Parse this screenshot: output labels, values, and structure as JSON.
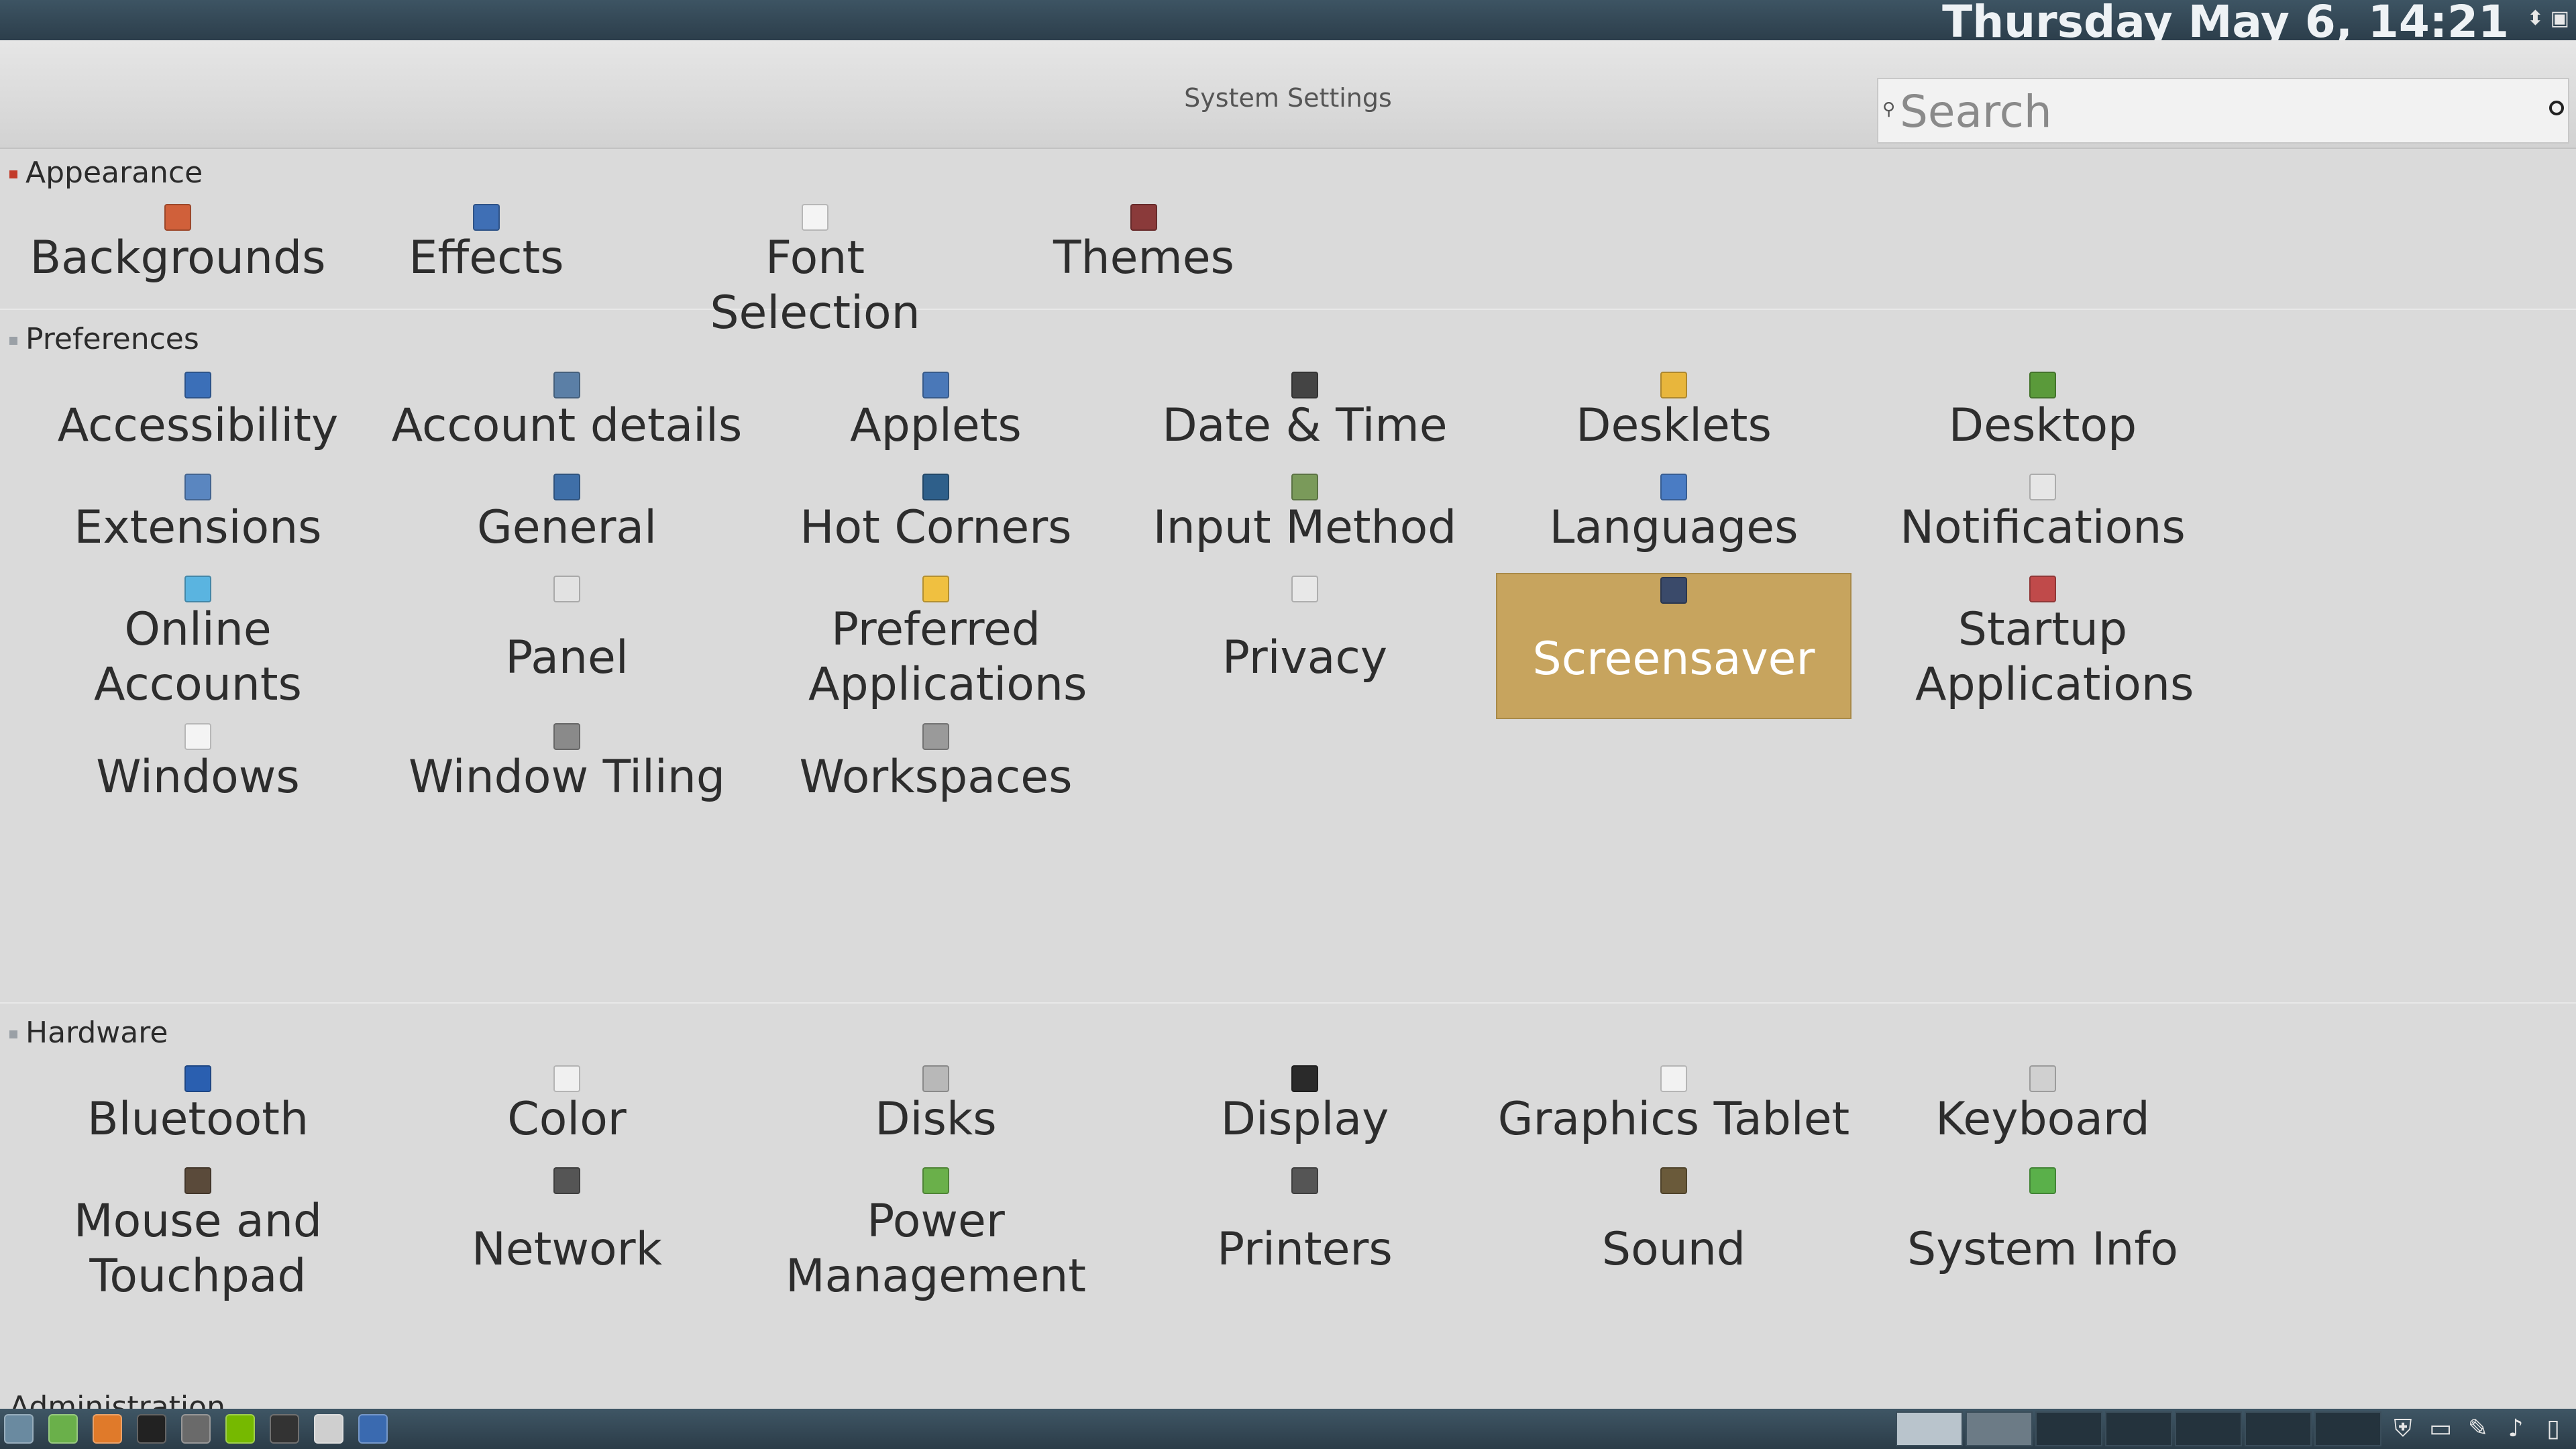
{
  "top_panel": {
    "clock": "Thursday May  6, 14:21"
  },
  "window": {
    "title": "System Settings",
    "minimize_label": "–",
    "maximize_label": "+",
    "close_label": "✕"
  },
  "search": {
    "placeholder": "Search",
    "value": ""
  },
  "sections": [
    {
      "title": "Appearance",
      "bullet_color": "#c23b2a",
      "items": [
        "Backgrounds",
        "Effects",
        "Font Selection",
        "Themes"
      ]
    },
    {
      "title": "Preferences",
      "bullet_color": "#9aa0a6",
      "items": [
        "Accessibility",
        "Account details",
        "Applets",
        "Date & Time",
        "Desklets",
        "Desktop",
        "Extensions",
        "General",
        "Hot Corners",
        "Input Method",
        "Languages",
        "Notifications",
        "Online Accounts",
        "Panel",
        "Preferred Applications",
        "Privacy",
        "Screensaver",
        "Startup Applications",
        "Windows",
        "Window Tiling",
        "Workspaces"
      ]
    },
    {
      "title": "Hardware",
      "bullet_color": "#9aa0a6",
      "items": [
        "Bluetooth",
        "Color",
        "Disks",
        "Display",
        "Graphics Tablet",
        "Keyboard",
        "Mouse and Touchpad",
        "Network",
        "Power Management",
        "Printers",
        "Sound",
        "System Info"
      ]
    },
    {
      "title": "Administration",
      "bullet_color": "#9aa0a6",
      "items": []
    }
  ],
  "selected_item": "Screensaver",
  "icons": {
    "Backgrounds": "backgrounds-icon",
    "Effects": "effects-icon",
    "Font Selection": "font-selection-icon",
    "Themes": "themes-icon",
    "Accessibility": "accessibility-icon",
    "Account details": "account-details-icon",
    "Applets": "applets-icon",
    "Date & Time": "date-time-icon",
    "Desklets": "desklets-icon",
    "Desktop": "desktop-icon",
    "Extensions": "extensions-icon",
    "General": "general-icon",
    "Hot Corners": "hot-corners-icon",
    "Input Method": "input-method-icon",
    "Languages": "languages-icon",
    "Notifications": "notifications-icon",
    "Online Accounts": "online-accounts-icon",
    "Panel": "panel-icon",
    "Preferred Applications": "preferred-applications-icon",
    "Privacy": "privacy-icon",
    "Screensaver": "screensaver-icon",
    "Startup Applications": "startup-applications-icon",
    "Windows": "windows-icon",
    "Window Tiling": "window-tiling-icon",
    "Workspaces": "workspaces-icon",
    "Bluetooth": "bluetooth-icon",
    "Color": "color-icon",
    "Disks": "disks-icon",
    "Display": "display-icon",
    "Graphics Tablet": "graphics-tablet-icon",
    "Keyboard": "keyboard-icon",
    "Mouse and Touchpad": "mouse-touchpad-icon",
    "Network": "network-icon",
    "Power Management": "power-management-icon",
    "Printers": "printers-icon",
    "Sound": "sound-icon",
    "System Info": "system-info-icon"
  },
  "icon_colors": {
    "Backgrounds": "#d0603a",
    "Effects": "#3f6fb5",
    "Font Selection": "#f4f4f4",
    "Themes": "#8a3a3a",
    "Accessibility": "#3b6fb8",
    "Account details": "#5b7fa6",
    "Applets": "#4a78b8",
    "Date & Time": "#444444",
    "Desklets": "#e8b63c",
    "Desktop": "#5a9a3a",
    "Extensions": "#5a86c0",
    "General": "#3f6fa8",
    "Hot Corners": "#2e5f8a",
    "Input Method": "#7a9a5a",
    "Languages": "#4a7cc4",
    "Notifications": "#e6e6e6",
    "Online Accounts": "#5ab4e0",
    "Panel": "#e2e2e2",
    "Preferred Applications": "#f0c040",
    "Privacy": "#e8e8e8",
    "Screensaver": "#3a4a6a",
    "Startup Applications": "#c04a4a",
    "Windows": "#f4f4f4",
    "Window Tiling": "#8a8a8a",
    "Workspaces": "#9a9a9a",
    "Bluetooth": "#2a5fb0",
    "Color": "#f0f0f0",
    "Disks": "#b8b8b8",
    "Display": "#2a2a2a",
    "Graphics Tablet": "#f2f2f2",
    "Keyboard": "#d0d0d0",
    "Mouse and Touchpad": "#5a4a3a",
    "Network": "#555555",
    "Power Management": "#6ab04a",
    "Printers": "#555555",
    "Sound": "#6a5a3a",
    "System Info": "#5ab04a"
  },
  "selection_color": "#c7a45e",
  "taskbar": {
    "launchers": [
      "menu-icon",
      "files-icon",
      "firefox-icon",
      "terminal-icon",
      "trash-icon",
      "nvidia-icon",
      "camera-icon",
      "notes-icon",
      "settings-icon"
    ],
    "tray": [
      "shield-icon",
      "keyboard-icon",
      "pen-icon",
      "music-icon",
      "battery-icon"
    ]
  }
}
